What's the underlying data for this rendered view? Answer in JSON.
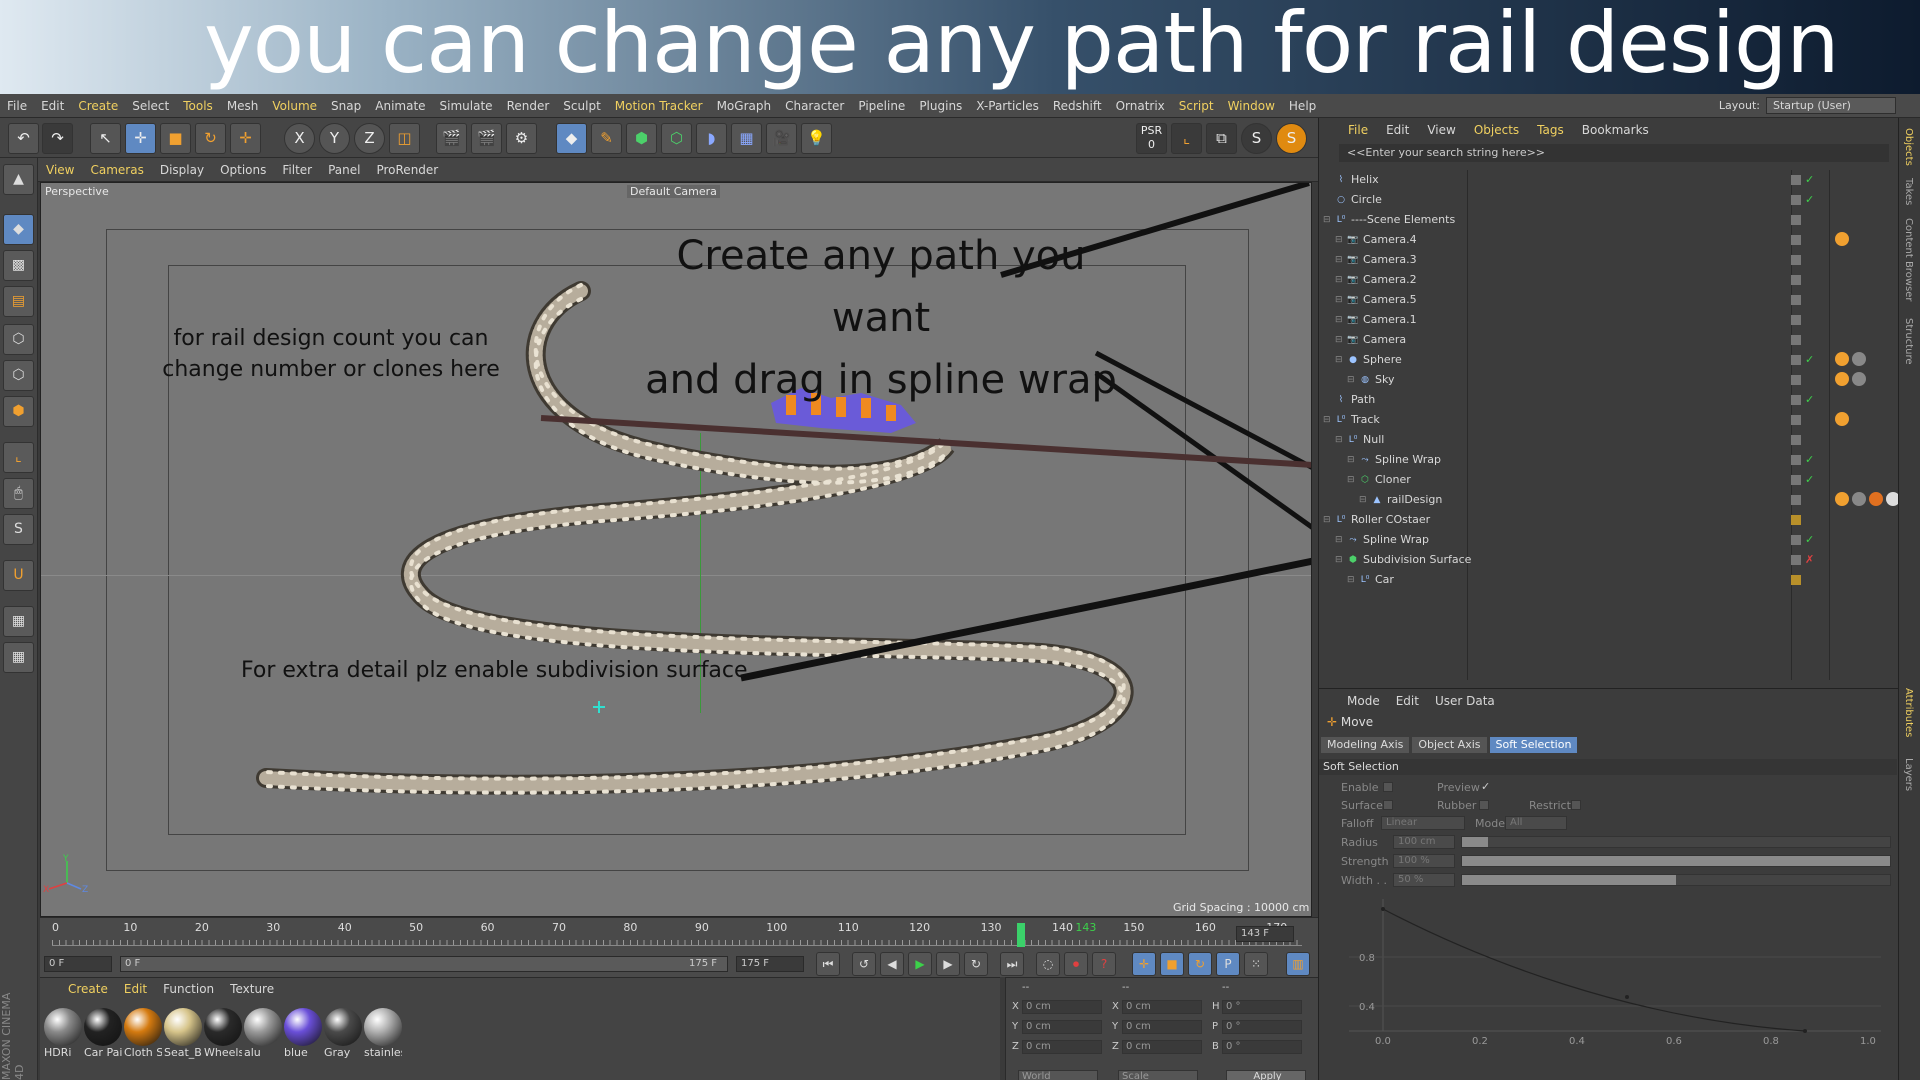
{
  "banner": {
    "text": "you can change any path for rail design"
  },
  "menubar": {
    "items": [
      "File",
      "Edit",
      "Create",
      "Select",
      "Tools",
      "Mesh",
      "Volume",
      "Snap",
      "Animate",
      "Simulate",
      "Render",
      "Sculpt",
      "Motion Tracker",
      "MoGraph",
      "Character",
      "Pipeline",
      "Plugins",
      "X-Particles",
      "Redshift",
      "Ornatrix",
      "Script",
      "Window",
      "Help"
    ],
    "highlighted": [
      "Create",
      "Tools",
      "Volume",
      "Motion Tracker",
      "Script",
      "Window"
    ],
    "layout_label": "Layout:",
    "layout_value": "Startup (User)"
  },
  "toolbar": {
    "axis_x": "X",
    "axis_y": "Y",
    "axis_z": "Z",
    "psr_label": "PSR",
    "psr_value": "0",
    "s_label": "S"
  },
  "viewport": {
    "menu": [
      "View",
      "Cameras",
      "Display",
      "Options",
      "Filter",
      "Panel",
      "ProRender"
    ],
    "view_name": "Perspective",
    "camera_name": "Default Camera",
    "grid_spacing": "Grid Spacing : 10000 cm",
    "axis_y": "Y",
    "axis_x": "X",
    "axis_z": "Z"
  },
  "annotations": {
    "path_line1": "Create any path you want",
    "path_line2": "and drag in spline wrap",
    "rail_line1": "for rail design count you can",
    "rail_line2": "change number or clones here",
    "subdiv": "For extra detail plz enable subdivision surface"
  },
  "timeline": {
    "ticks": [
      "0",
      "10",
      "20",
      "30",
      "40",
      "50",
      "60",
      "70",
      "80",
      "90",
      "100",
      "110",
      "120",
      "130",
      "140",
      "143",
      "150",
      "160",
      "170"
    ],
    "current_frame": "143 F",
    "start_field": "0 F",
    "range_start": "0 F",
    "range_end": "175 F",
    "end_field": "175 F"
  },
  "materials": {
    "menu": [
      "Create",
      "Edit",
      "Function",
      "Texture"
    ],
    "items": [
      {
        "name": "HDRi",
        "color": "#8a8a8a"
      },
      {
        "name": "Car Pain",
        "color": "#222222"
      },
      {
        "name": "Cloth Se",
        "color": "#d47a10"
      },
      {
        "name": "Seat_Be",
        "color": "#d6c48a"
      },
      {
        "name": "Wheels",
        "color": "#2a2a2a"
      },
      {
        "name": "alu",
        "color": "#9a9a9a"
      },
      {
        "name": "blue",
        "color": "#6a4fd8"
      },
      {
        "name": "Gray",
        "color": "#4a4a4a"
      },
      {
        "name": "stainles",
        "color": "#b0b0b0"
      }
    ]
  },
  "coords": {
    "header1": "--",
    "header2": "--",
    "header3": "--",
    "rows": [
      {
        "a": "X",
        "av": "0 cm",
        "b": "X",
        "bv": "0 cm",
        "c": "H",
        "cv": "0 °"
      },
      {
        "a": "Y",
        "av": "0 cm",
        "b": "Y",
        "bv": "0 cm",
        "c": "P",
        "cv": "0 °"
      },
      {
        "a": "Z",
        "av": "0 cm",
        "b": "Z",
        "bv": "0 cm",
        "c": "B",
        "cv": "0 °"
      }
    ],
    "world": "World",
    "scale": "Scale",
    "apply": "Apply"
  },
  "object_manager": {
    "menu": [
      "File",
      "Edit",
      "View",
      "Objects",
      "Tags",
      "Bookmarks"
    ],
    "highlighted": [
      "File",
      "Objects",
      "Tags"
    ],
    "search_placeholder": "<<Enter your search string here>>",
    "objects": [
      {
        "name": "Helix",
        "indent": 0,
        "icon": "helix-icon",
        "check": "✓",
        "tags": 0
      },
      {
        "name": "Circle",
        "indent": 0,
        "icon": "circle-spline-icon",
        "check": "✓",
        "tags": 0
      },
      {
        "name": "----Scene Elements",
        "indent": 0,
        "icon": "null-icon",
        "check": "",
        "tags": 0
      },
      {
        "name": "Camera.4",
        "indent": 1,
        "icon": "camera-icon",
        "check": "",
        "tags": 1
      },
      {
        "name": "Camera.3",
        "indent": 1,
        "icon": "camera-icon",
        "check": "",
        "tags": 0
      },
      {
        "name": "Camera.2",
        "indent": 1,
        "icon": "camera-icon",
        "check": "",
        "tags": 0
      },
      {
        "name": "Camera.5",
        "indent": 1,
        "icon": "camera-icon",
        "check": "",
        "tags": 0
      },
      {
        "name": "Camera.1",
        "indent": 1,
        "icon": "camera-icon",
        "check": "",
        "tags": 0
      },
      {
        "name": "Camera",
        "indent": 1,
        "icon": "camera-icon",
        "check": "",
        "tags": 0
      },
      {
        "name": "Sphere",
        "indent": 1,
        "icon": "sphere-icon",
        "check": "✓",
        "tags": 2
      },
      {
        "name": "Sky",
        "indent": 2,
        "icon": "sky-icon",
        "check": "",
        "tags": 2
      },
      {
        "name": "Path",
        "indent": 0,
        "icon": "spline-icon",
        "check": "✓",
        "tags": 0
      },
      {
        "name": "Track",
        "indent": 0,
        "icon": "null-icon",
        "check": "",
        "tags": 1
      },
      {
        "name": "Null",
        "indent": 1,
        "icon": "null-icon",
        "check": "",
        "tags": 0
      },
      {
        "name": "Spline Wrap",
        "indent": 2,
        "icon": "spline-wrap-icon",
        "check": "✓",
        "tags": 0
      },
      {
        "name": "Cloner",
        "indent": 2,
        "icon": "cloner-icon",
        "check": "✓",
        "tags": 0
      },
      {
        "name": "railDesign",
        "indent": 3,
        "icon": "polygon-icon",
        "check": "",
        "tags": 9
      },
      {
        "name": "Roller COstaer",
        "indent": 0,
        "icon": "null-icon",
        "check": "",
        "tags": 0
      },
      {
        "name": "Spline Wrap",
        "indent": 1,
        "icon": "spline-wrap-icon",
        "check": "✓",
        "tags": 0
      },
      {
        "name": "Subdivision Surface",
        "indent": 1,
        "icon": "subdivision-icon",
        "check": "✗",
        "tags": 0
      },
      {
        "name": "Car",
        "indent": 2,
        "icon": "null-icon",
        "check": "",
        "tags": 0
      }
    ]
  },
  "attributes": {
    "menu": [
      "Mode",
      "Edit",
      "User Data"
    ],
    "tool_name": "Move",
    "tabs": [
      "Modeling Axis",
      "Object Axis",
      "Soft Selection"
    ],
    "active_tab": "Soft Selection",
    "section": "Soft Selection",
    "enable": "Enable",
    "preview": "Preview",
    "preview_check": "✓",
    "surface": "Surface",
    "rubber": "Rubber",
    "restrict": "Restrict",
    "falloff": "Falloff",
    "falloff_value": "Linear",
    "mode": "Mode",
    "mode_value": "All",
    "radius": "Radius",
    "radius_value": "100 cm",
    "radius_fill": 0.06,
    "strength": "Strength",
    "strength_value": "100 %",
    "strength_fill": 1.0,
    "width": "Width . .",
    "width_value": "50 %",
    "width_fill": 0.5,
    "graph_y": [
      "0.8",
      "0.4"
    ],
    "graph_x": [
      "0.0",
      "0.2",
      "0.4",
      "0.6",
      "0.8",
      "1.0"
    ]
  },
  "right_tabs": [
    "Objects",
    "Takes",
    "Content Browser",
    "Structure",
    "Attributes",
    "Layers"
  ],
  "branding": "MAXON CINEMA 4D"
}
